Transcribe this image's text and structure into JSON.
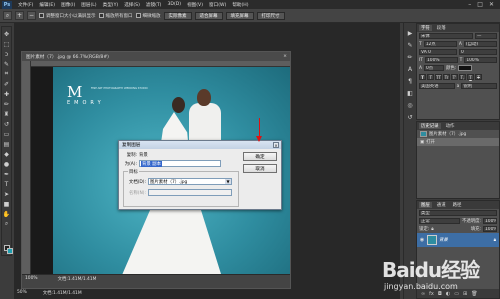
{
  "app": {
    "logo": "Ps",
    "menu": [
      "文件(F)",
      "编辑(E)",
      "图像(I)",
      "图层(L)",
      "类型(Y)",
      "选择(S)",
      "滤镜(T)",
      "3D(D)",
      "视图(V)",
      "窗口(W)",
      "帮助(H)"
    ],
    "window_controls": [
      "–",
      "□",
      "✕"
    ]
  },
  "options_bar": {
    "checks": [
      "调整窗口大小以满屏显示",
      "缩放所有窗口",
      "细微缩放"
    ],
    "buttons": [
      "实际像素",
      "适合屏幕",
      "填充屏幕",
      "打印尺寸"
    ]
  },
  "document": {
    "tab_title": "图片素材（7）.jpg @ 66.7%(RGB/8#)",
    "close": "×",
    "photo_logo": {
      "letter": "M",
      "word": "EMORY",
      "tagline": "FINE ART PHOTOGRAPHY WEDDING STUDIO"
    },
    "status_zoom": "100%",
    "status_doc": "文档:1.41M/1.41M",
    "status_zoom_2": "50%",
    "status_doc_2": "文档:1.41M/1.41M"
  },
  "dialog": {
    "title": "复制图层",
    "close": "×",
    "copy_label": "复制:",
    "copy_value": "背景",
    "as_label": "为(A):",
    "as_value": "背景 副本",
    "group_title": "目标",
    "document_label": "文档(D):",
    "document_value": "图片素材（7）.jpg",
    "name_label": "名称(N):",
    "name_value": "",
    "ok": "确定",
    "cancel": "取消"
  },
  "dock": {
    "icons": [
      "play-icon",
      "brush-icon",
      "pencil-icon",
      "text-icon",
      "paragraph-icon",
      "layers-icon",
      "channels-icon",
      "history-icon"
    ]
  },
  "character_panel": {
    "tabs": [
      "字符",
      "段落"
    ],
    "font_family": "宋体",
    "font_style": "—",
    "size": "12点",
    "leading": "(自动)",
    "tracking": "VA 0",
    "kerning": "0",
    "scale_v": "100%",
    "scale_h": "100%",
    "baseline": "0点",
    "color_label": "颜色:",
    "style_buttons": [
      "T",
      "T",
      "TT",
      "Tr",
      "T'",
      "T,",
      "T",
      "T"
    ],
    "language": "美国英语",
    "aa": "锐利"
  },
  "history_panel": {
    "tabs": [
      "历史记录",
      "动作"
    ],
    "snapshot": "图片素材（7）.jpg",
    "steps": [
      "打开"
    ]
  },
  "layers_panel": {
    "tabs": [
      "图层",
      "通道",
      "路径"
    ],
    "kind": "类型",
    "blend": "正常",
    "opacity_label": "不透明度:",
    "opacity": "100%",
    "lock_label": "锁定:",
    "fill_label": "填充:",
    "fill": "100%",
    "layers": [
      {
        "name": "背景",
        "visible": true
      }
    ],
    "footer_icons": [
      "link-icon",
      "fx-icon",
      "mask-icon",
      "adjust-icon",
      "folder-icon",
      "new-layer-icon",
      "trash-icon"
    ]
  },
  "watermark": {
    "brand": "Baidu经验",
    "url": "jingyan.baidu.com"
  }
}
